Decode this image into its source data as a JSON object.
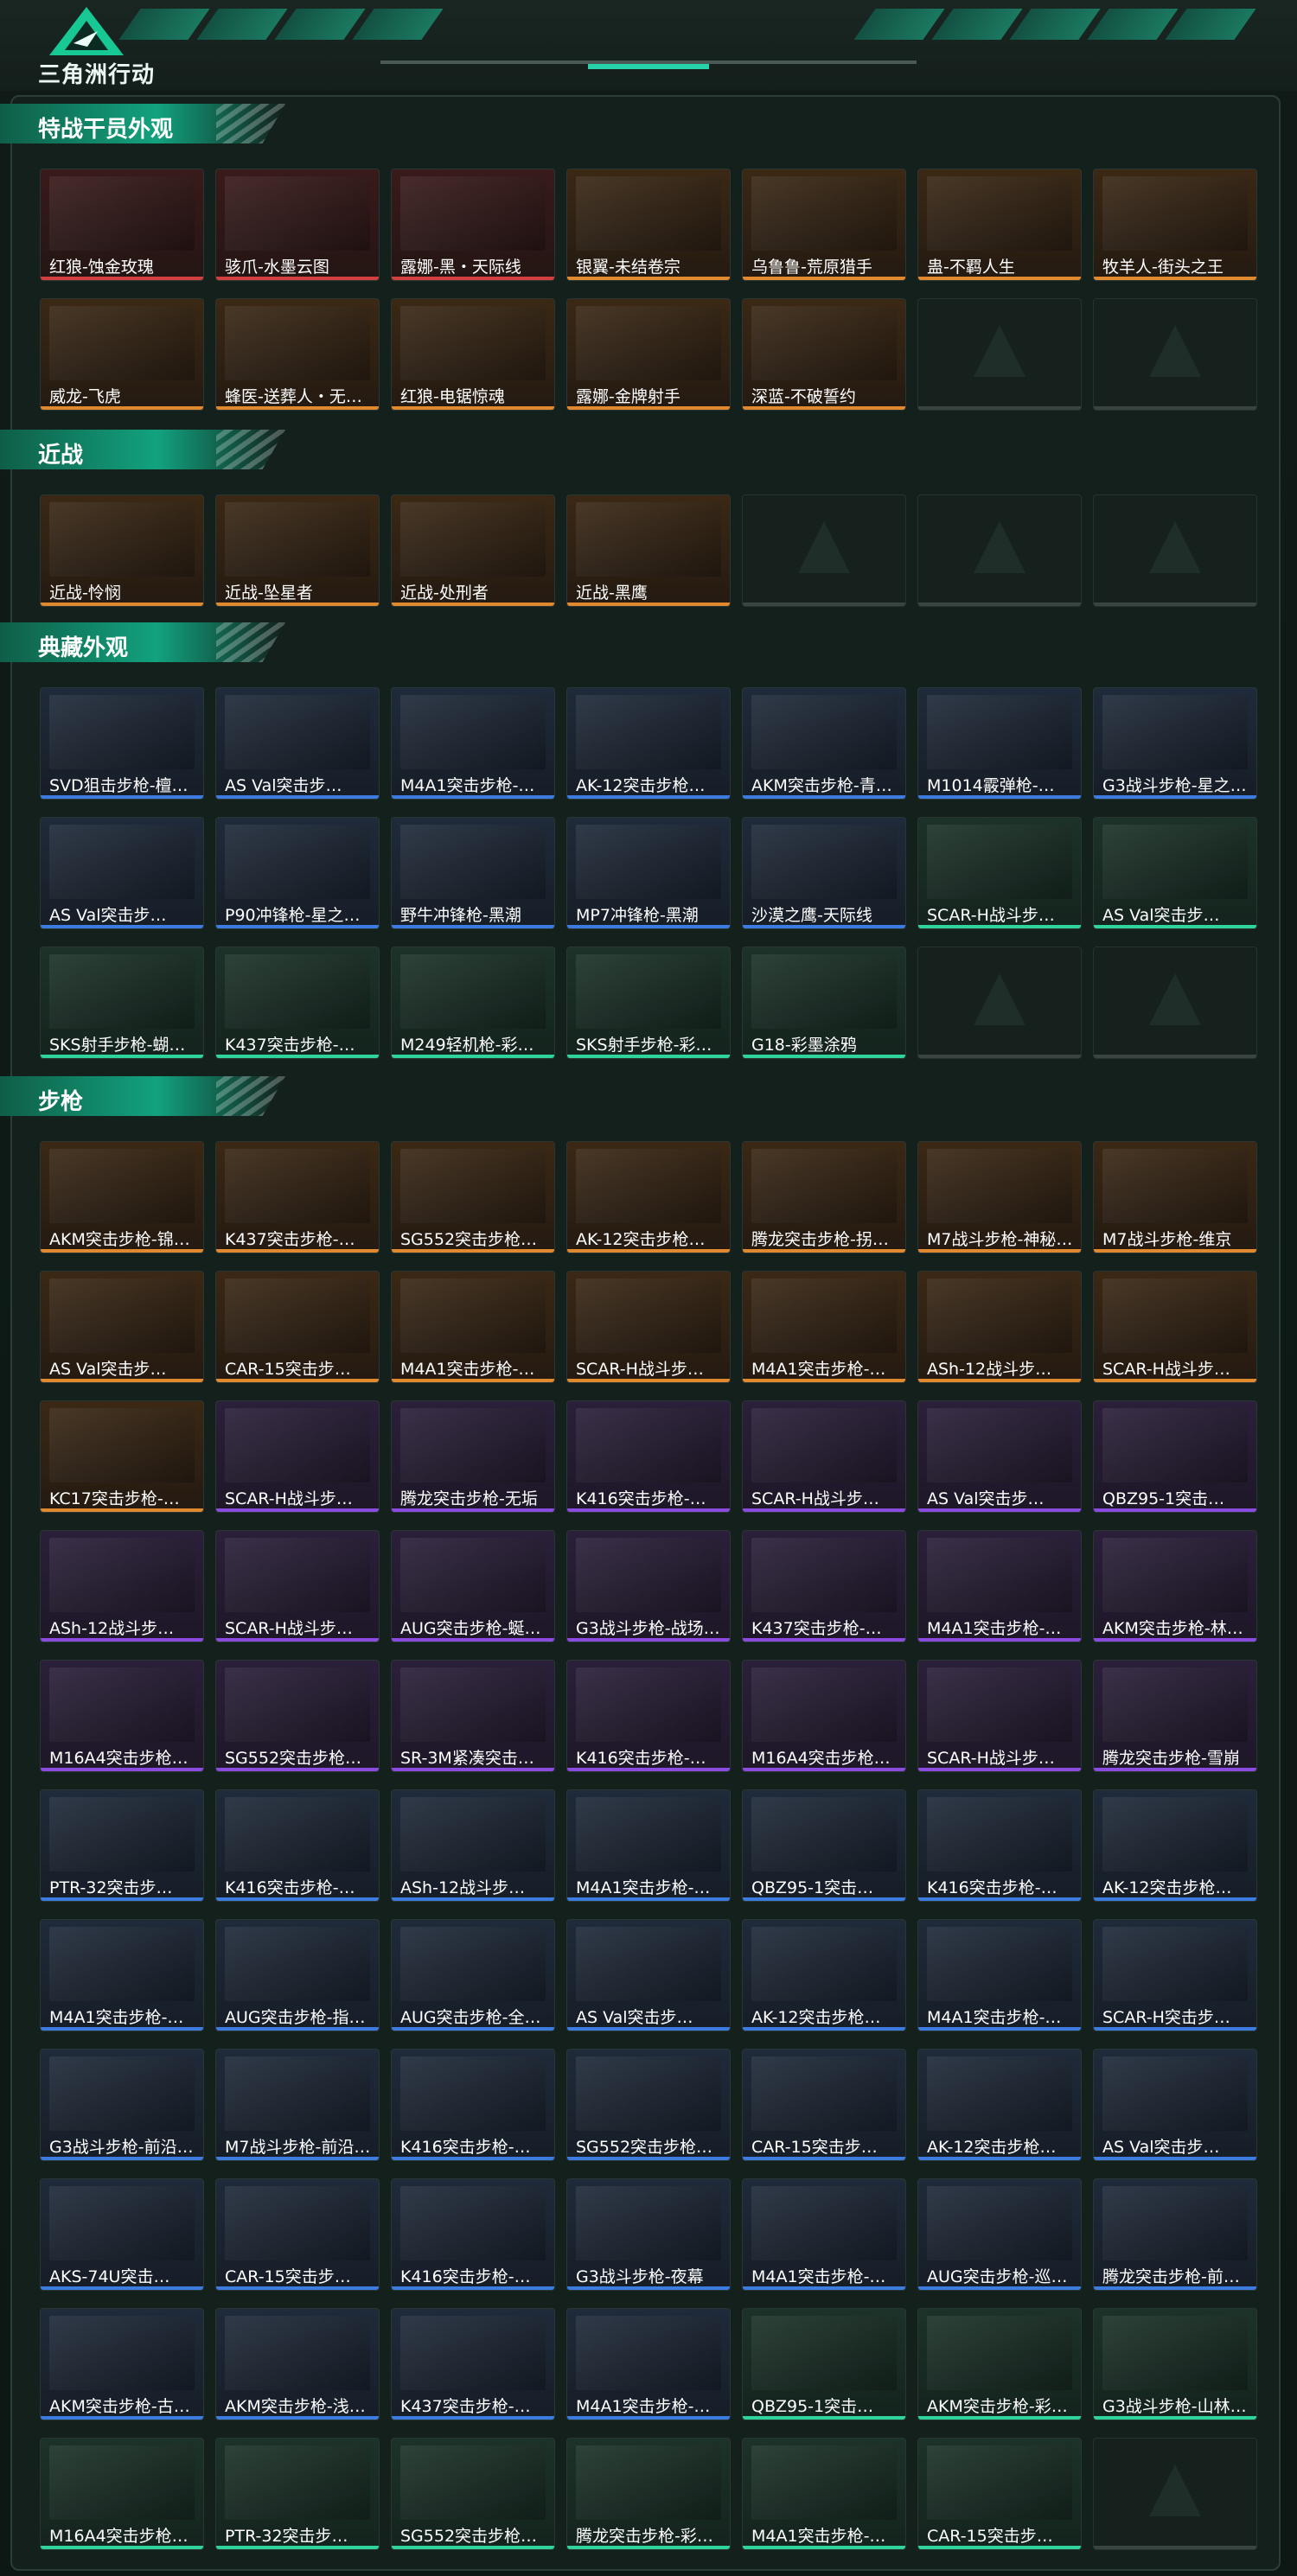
{
  "header": {
    "brand": "三角洲行动",
    "colors": {
      "accent": "#27d3a8",
      "brand_green": "#12a27e"
    }
  },
  "sections": [
    {
      "title": "特战干员外观",
      "cols": 7,
      "items": [
        {
          "label": "红狼-蚀金玫瑰",
          "rarity": "red"
        },
        {
          "label": "骇爪-水墨云图",
          "rarity": "red"
        },
        {
          "label": "露娜-黑・天际线",
          "rarity": "red"
        },
        {
          "label": "银翼-未结卷宗",
          "rarity": "gold"
        },
        {
          "label": "乌鲁鲁-荒原猎手",
          "rarity": "gold"
        },
        {
          "label": "蛊-不羁人生",
          "rarity": "gold"
        },
        {
          "label": "牧羊人-街头之王",
          "rarity": "gold"
        },
        {
          "label": "威龙-飞虎",
          "rarity": "gold"
        },
        {
          "label": "蜂医-送葬人・无题…",
          "rarity": "gold"
        },
        {
          "label": "红狼-电锯惊魂",
          "rarity": "gold"
        },
        {
          "label": "露娜-金牌射手",
          "rarity": "gold"
        },
        {
          "label": "深蓝-不破誓约",
          "rarity": "gold"
        },
        {
          "label": "",
          "rarity": "empty"
        },
        {
          "label": "",
          "rarity": "empty"
        }
      ]
    },
    {
      "title": "近战",
      "cols": 7,
      "items": [
        {
          "label": "近战-怜悯",
          "rarity": "gold"
        },
        {
          "label": "近战-坠星者",
          "rarity": "gold"
        },
        {
          "label": "近战-处刑者",
          "rarity": "gold"
        },
        {
          "label": "近战-黑鹰",
          "rarity": "gold"
        },
        {
          "label": "",
          "rarity": "empty"
        },
        {
          "label": "",
          "rarity": "empty"
        },
        {
          "label": "",
          "rarity": "empty"
        }
      ]
    },
    {
      "title": "典藏外观",
      "cols": 7,
      "items": [
        {
          "label": "SVD狙击步枪-檀…",
          "rarity": "blue"
        },
        {
          "label": "AS Val突击步…",
          "rarity": "blue"
        },
        {
          "label": "M4A1突击步枪-…",
          "rarity": "blue"
        },
        {
          "label": "AK-12突击步枪…",
          "rarity": "blue"
        },
        {
          "label": "AKM突击步枪-青…",
          "rarity": "blue"
        },
        {
          "label": "M1014霰弹枪-…",
          "rarity": "blue"
        },
        {
          "label": "G3战斗步枪-星之…",
          "rarity": "blue"
        },
        {
          "label": "AS Val突击步…",
          "rarity": "blue"
        },
        {
          "label": "P90冲锋枪-星之…",
          "rarity": "blue"
        },
        {
          "label": "野牛冲锋枪-黑潮",
          "rarity": "blue"
        },
        {
          "label": "MP7冲锋枪-黑潮",
          "rarity": "blue"
        },
        {
          "label": "沙漠之鹰-天际线",
          "rarity": "blue"
        },
        {
          "label": "SCAR-H战斗步…",
          "rarity": "green"
        },
        {
          "label": "AS Val突击步…",
          "rarity": "green"
        },
        {
          "label": "SKS射手步枪-蝴…",
          "rarity": "green"
        },
        {
          "label": "K437突击步枪-…",
          "rarity": "green"
        },
        {
          "label": "M249轻机枪-彩…",
          "rarity": "green"
        },
        {
          "label": "SKS射手步枪-彩…",
          "rarity": "green"
        },
        {
          "label": "G18-彩墨涂鸦",
          "rarity": "green"
        },
        {
          "label": "",
          "rarity": "empty"
        },
        {
          "label": "",
          "rarity": "empty"
        }
      ]
    },
    {
      "title": "步枪",
      "cols": 7,
      "items": [
        {
          "label": "AKM突击步枪-锦…",
          "rarity": "gold"
        },
        {
          "label": "K437突击步枪-…",
          "rarity": "gold"
        },
        {
          "label": "SG552突击步枪…",
          "rarity": "gold"
        },
        {
          "label": "AK-12突击步枪…",
          "rarity": "gold"
        },
        {
          "label": "腾龙突击步枪-拐点…",
          "rarity": "gold"
        },
        {
          "label": "M7战斗步枪-神秘…",
          "rarity": "gold"
        },
        {
          "label": "M7战斗步枪-维京",
          "rarity": "gold"
        },
        {
          "label": "AS Val突击步…",
          "rarity": "gold"
        },
        {
          "label": "CAR-15突击步…",
          "rarity": "gold"
        },
        {
          "label": "M4A1突击步枪-…",
          "rarity": "gold"
        },
        {
          "label": "SCAR-H战斗步…",
          "rarity": "gold"
        },
        {
          "label": "M4A1突击步枪-…",
          "rarity": "gold"
        },
        {
          "label": "ASh-12战斗步…",
          "rarity": "gold"
        },
        {
          "label": "SCAR-H战斗步…",
          "rarity": "gold"
        },
        {
          "label": "KC17突击步枪-…",
          "rarity": "gold"
        },
        {
          "label": "SCAR-H战斗步…",
          "rarity": "purple"
        },
        {
          "label": "腾龙突击步枪-无垢",
          "rarity": "purple"
        },
        {
          "label": "K416突击步枪-…",
          "rarity": "purple"
        },
        {
          "label": "SCAR-H战斗步…",
          "rarity": "purple"
        },
        {
          "label": "AS Val突击步…",
          "rarity": "purple"
        },
        {
          "label": "QBZ95-1突击…",
          "rarity": "purple"
        },
        {
          "label": "ASh-12战斗步…",
          "rarity": "purple"
        },
        {
          "label": "SCAR-H战斗步…",
          "rarity": "purple"
        },
        {
          "label": "AUG突击步枪-蜒…",
          "rarity": "purple"
        },
        {
          "label": "G3战斗步枪-战场…",
          "rarity": "purple"
        },
        {
          "label": "K437突击步枪-…",
          "rarity": "purple"
        },
        {
          "label": "M4A1突击步枪-…",
          "rarity": "purple"
        },
        {
          "label": "AKM突击步枪-林…",
          "rarity": "purple"
        },
        {
          "label": "M16A4突击步枪…",
          "rarity": "purple"
        },
        {
          "label": "SG552突击步枪…",
          "rarity": "purple"
        },
        {
          "label": "SR-3M紧凑突击…",
          "rarity": "purple"
        },
        {
          "label": "K416突击步枪-…",
          "rarity": "purple"
        },
        {
          "label": "M16A4突击步枪…",
          "rarity": "purple"
        },
        {
          "label": "SCAR-H战斗步…",
          "rarity": "purple"
        },
        {
          "label": "腾龙突击步枪-雪崩",
          "rarity": "purple"
        },
        {
          "label": "PTR-32突击步…",
          "rarity": "blue"
        },
        {
          "label": "K416突击步枪-…",
          "rarity": "blue"
        },
        {
          "label": "ASh-12战斗步…",
          "rarity": "blue"
        },
        {
          "label": "M4A1突击步枪-…",
          "rarity": "blue"
        },
        {
          "label": "QBZ95-1突击…",
          "rarity": "blue"
        },
        {
          "label": "K416突击步枪-…",
          "rarity": "blue"
        },
        {
          "label": "AK-12突击步枪…",
          "rarity": "blue"
        },
        {
          "label": "M4A1突击步枪-…",
          "rarity": "blue"
        },
        {
          "label": "AUG突击步枪-指…",
          "rarity": "blue"
        },
        {
          "label": "AUG突击步枪-全…",
          "rarity": "blue"
        },
        {
          "label": "AS Val突击步…",
          "rarity": "blue"
        },
        {
          "label": "AK-12突击步枪…",
          "rarity": "blue"
        },
        {
          "label": "M4A1突击步枪-…",
          "rarity": "blue"
        },
        {
          "label": "SCAR-H突击步…",
          "rarity": "blue"
        },
        {
          "label": "G3战斗步枪-前沿…",
          "rarity": "blue"
        },
        {
          "label": "M7战斗步枪-前沿…",
          "rarity": "blue"
        },
        {
          "label": "K416突击步枪-…",
          "rarity": "blue"
        },
        {
          "label": "SG552突击步枪…",
          "rarity": "blue"
        },
        {
          "label": "CAR-15突击步…",
          "rarity": "blue"
        },
        {
          "label": "AK-12突击步枪…",
          "rarity": "blue"
        },
        {
          "label": "AS Val突击步…",
          "rarity": "blue"
        },
        {
          "label": "AKS-74U突击…",
          "rarity": "blue"
        },
        {
          "label": "CAR-15突击步…",
          "rarity": "blue"
        },
        {
          "label": "K416突击步枪-…",
          "rarity": "blue"
        },
        {
          "label": "G3战斗步枪-夜幕",
          "rarity": "blue"
        },
        {
          "label": "M4A1突击步枪-…",
          "rarity": "blue"
        },
        {
          "label": "AUG突击步枪-巡…",
          "rarity": "blue"
        },
        {
          "label": "腾龙突击步枪-前沿…",
          "rarity": "blue"
        },
        {
          "label": "AKM突击步枪-古…",
          "rarity": "blue"
        },
        {
          "label": "AKM突击步枪-浅…",
          "rarity": "blue"
        },
        {
          "label": "K437突击步枪-…",
          "rarity": "blue"
        },
        {
          "label": "M4A1突击步枪-…",
          "rarity": "blue"
        },
        {
          "label": "QBZ95-1突击…",
          "rarity": "green"
        },
        {
          "label": "AKM突击步枪-彩…",
          "rarity": "green"
        },
        {
          "label": "G3战斗步枪-山林…",
          "rarity": "green"
        },
        {
          "label": "M16A4突击步枪…",
          "rarity": "green"
        },
        {
          "label": "PTR-32突击步…",
          "rarity": "green"
        },
        {
          "label": "SG552突击步枪…",
          "rarity": "green"
        },
        {
          "label": "腾龙突击步枪-彩墨…",
          "rarity": "green"
        },
        {
          "label": "M4A1突击步枪-…",
          "rarity": "green"
        },
        {
          "label": "CAR-15突击步…",
          "rarity": "green"
        },
        {
          "label": "",
          "rarity": "empty"
        }
      ]
    }
  ]
}
